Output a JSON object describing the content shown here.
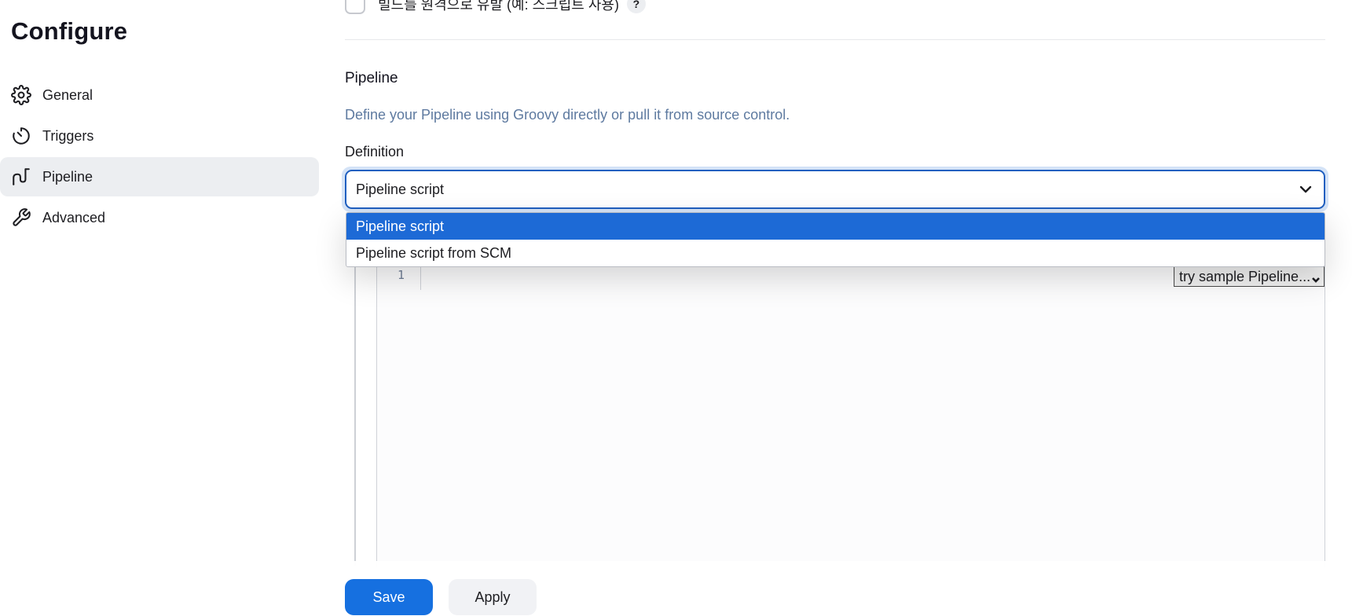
{
  "sidebar": {
    "title": "Configure",
    "items": [
      {
        "label": "General",
        "icon": "gear-icon",
        "active": false
      },
      {
        "label": "Triggers",
        "icon": "timer-icon",
        "active": false
      },
      {
        "label": "Pipeline",
        "icon": "pipeline-icon",
        "active": true
      },
      {
        "label": "Advanced",
        "icon": "wrench-icon",
        "active": false
      }
    ]
  },
  "main": {
    "top_option": {
      "label": "빌드를 원격으로 유발 (예: 스크립트 사용)",
      "help": "?",
      "checked": false
    },
    "pipeline": {
      "title": "Pipeline",
      "description": "Define your Pipeline using Groovy directly or pull it from source control.",
      "definition_label": "Definition",
      "definition_value": "Pipeline script",
      "dropdown_options": [
        "Pipeline script",
        "Pipeline script from SCM"
      ],
      "selected_index": 0
    },
    "editor": {
      "line_number": "1",
      "sample_select": "try sample Pipeline..."
    }
  },
  "footer": {
    "save_label": "Save",
    "apply_label": "Apply"
  },
  "colors": {
    "accent": "#1670e0",
    "option_selected": "#1d6ad6",
    "description": "#5e7aa0"
  }
}
